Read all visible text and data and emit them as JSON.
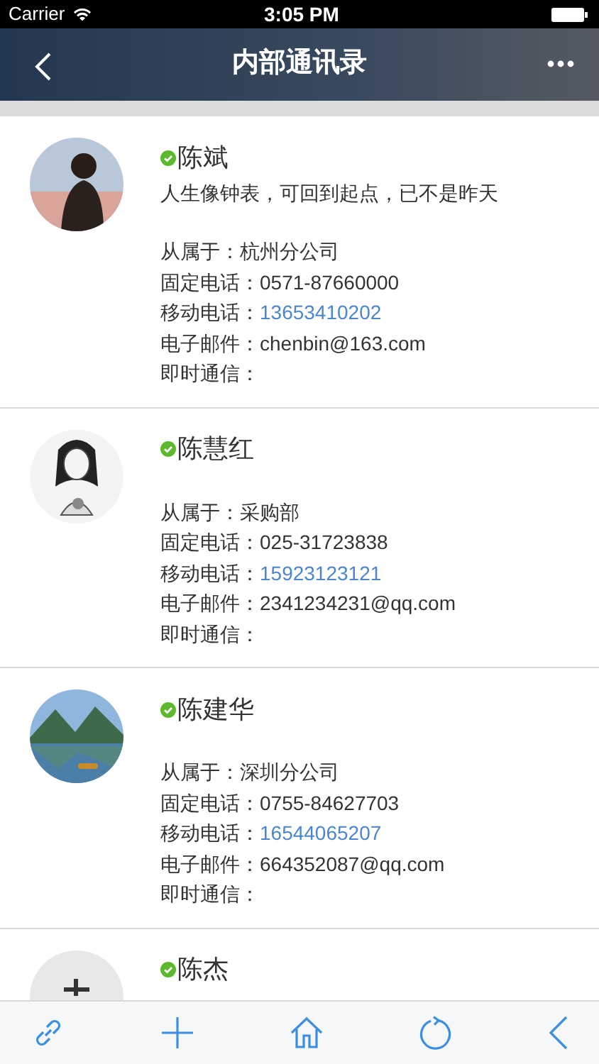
{
  "status_bar": {
    "carrier": "Carrier",
    "time": "3:05 PM"
  },
  "nav_bar": {
    "title": "内部通讯录"
  },
  "contacts": [
    {
      "name": "陈斌",
      "online": true,
      "motto": "人生像钟表，可回到起点，已不是昨天",
      "fields": [
        {
          "label": "从属于：",
          "value": "杭州分公司",
          "kind": "text"
        },
        {
          "label": "固定电话：",
          "value": "0571-87660000",
          "kind": "text"
        },
        {
          "label": "移动电话：",
          "value": "13653410202",
          "kind": "link"
        },
        {
          "label": "电子邮件：",
          "value": "chenbin@163.com",
          "kind": "text"
        },
        {
          "label": "即时通信："
        }
      ]
    },
    {
      "name": "陈慧红",
      "online": true,
      "fields": [
        {
          "label": "从属于：",
          "value": "采购部",
          "kind": "text"
        },
        {
          "label": "固定电话：",
          "value": "025-31723838",
          "kind": "text"
        },
        {
          "label": "移动电话：",
          "value": "15923123121",
          "kind": "link"
        },
        {
          "label": "电子邮件：",
          "value": "2341234231@qq.com",
          "kind": "text"
        },
        {
          "label": "即时通信："
        }
      ]
    },
    {
      "name": "陈建华",
      "online": true,
      "fields": [
        {
          "label": "从属于：",
          "value": "深圳分公司",
          "kind": "text"
        },
        {
          "label": "固定电话：",
          "value": "0755-84627703",
          "kind": "text"
        },
        {
          "label": "移动电话：",
          "value": "16544065207",
          "kind": "link"
        },
        {
          "label": "电子邮件：",
          "value": "664352087@qq.com",
          "kind": "text"
        },
        {
          "label": "即时通信："
        }
      ]
    },
    {
      "name": "陈杰",
      "online": true
    }
  ]
}
